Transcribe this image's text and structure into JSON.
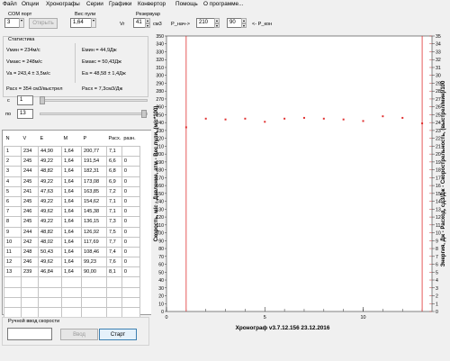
{
  "menu": [
    "Файл",
    "Опции",
    "Хронографы",
    "Серии",
    "Графики",
    "Конвертор",
    "Помощь",
    "О программе..."
  ],
  "top": {
    "com_label": "COM порт",
    "com_value": "3",
    "open_label": "Открыть",
    "weight_label": "Вес пули",
    "weight_value": "1,64",
    "reservoir_label": "Резервуар",
    "vr_label": "Vr",
    "vr_value": "41",
    "cm3_label": "см3",
    "p_start_label": "P_нач->",
    "p_start_value": "210",
    "p_end_value": "90",
    "p_end_label": "<- P_кон"
  },
  "stats": {
    "title": "Статистика",
    "vmin": "Vмин = 234м/с",
    "emin": "Емин = 44,9Дж",
    "vmax": "Vмакс = 248м/с",
    "emax": "Емакс = 50,43Дж",
    "vavg": "Va = 243,4 ± 3,5м/с",
    "eavg": "Еа = 48,58 ± 1,4Дж",
    "flow_shot": "Расх = 354 см3/выстрел",
    "flow": "Расх = 7,3см3/Дж"
  },
  "range": {
    "from_label": "с",
    "from_value": "1",
    "to_label": "по",
    "to_value": "13"
  },
  "table": {
    "headers": [
      "N",
      "V",
      "E",
      "M",
      "P",
      "Расх.",
      "разн."
    ],
    "rows": [
      [
        "1",
        "234",
        "44,90",
        "1,64",
        "200,77",
        "7,1",
        ""
      ],
      [
        "2",
        "245",
        "49,22",
        "1,64",
        "191,54",
        "6,6",
        "0"
      ],
      [
        "3",
        "244",
        "48,82",
        "1,64",
        "182,31",
        "6,8",
        "0"
      ],
      [
        "4",
        "245",
        "49,22",
        "1,64",
        "173,08",
        "6,9",
        "0"
      ],
      [
        "5",
        "241",
        "47,63",
        "1,64",
        "163,85",
        "7,2",
        "0"
      ],
      [
        "6",
        "245",
        "49,22",
        "1,64",
        "154,62",
        "7,1",
        "0"
      ],
      [
        "7",
        "246",
        "49,62",
        "1,64",
        "145,38",
        "7,1",
        "0"
      ],
      [
        "8",
        "245",
        "49,22",
        "1,64",
        "136,15",
        "7,3",
        "0"
      ],
      [
        "9",
        "244",
        "48,82",
        "1,64",
        "126,92",
        "7,5",
        "0"
      ],
      [
        "10",
        "242",
        "48,02",
        "1,64",
        "117,69",
        "7,7",
        "0"
      ],
      [
        "11",
        "248",
        "50,43",
        "1,64",
        "108,46",
        "7,4",
        "0"
      ],
      [
        "12",
        "246",
        "49,62",
        "1,64",
        "99,23",
        "7,6",
        "0"
      ],
      [
        "13",
        "239",
        "46,84",
        "1,64",
        "90,00",
        "8,1",
        "0"
      ]
    ]
  },
  "manual": {
    "label": "Ручной ввод скорости",
    "input_value": "",
    "enter_label": "Ввод",
    "start_label": "Старт"
  },
  "chart_data": {
    "type": "scatter",
    "title": "",
    "xlabel": "Хронограф v3.7.12.156     23.12.2016",
    "ylabel": "Скорость, м/с - Давление, атм - Вес пули, (м/с*100)",
    "y2label": "Энергия, Дж - Расход, сд3/Дж - Скорострельность, (выстрел/мин)/100",
    "x_ticks": [
      "0",
      "5",
      "10"
    ],
    "xlim": [
      0,
      13.5
    ],
    "ylim": [
      0,
      350
    ],
    "y_ticks": [
      0,
      10,
      20,
      30,
      40,
      50,
      60,
      70,
      80,
      90,
      100,
      110,
      120,
      130,
      140,
      150,
      160,
      170,
      180,
      190,
      200,
      210,
      220,
      230,
      240,
      250,
      260,
      270,
      280,
      290,
      300,
      310,
      320,
      330,
      340,
      350
    ],
    "y2lim": [
      0,
      35
    ],
    "y2_ticks": [
      0,
      1,
      2,
      3,
      4,
      5,
      6,
      7,
      8,
      9,
      10,
      11,
      12,
      13,
      14,
      15,
      16,
      17,
      18,
      19,
      20,
      21,
      22,
      23,
      24,
      25,
      26,
      27,
      28,
      29,
      30,
      31,
      32,
      33,
      34,
      35
    ],
    "red_lines_x": [
      1,
      13
    ],
    "series": [
      {
        "values": [
          [
            1,
            234
          ],
          [
            2,
            245
          ],
          [
            3,
            244
          ],
          [
            4,
            245
          ],
          [
            5,
            241
          ],
          [
            6,
            245
          ],
          [
            7,
            246
          ],
          [
            8,
            245
          ],
          [
            9,
            244
          ],
          [
            10,
            242
          ],
          [
            11,
            248
          ],
          [
            12,
            246
          ],
          [
            13,
            239
          ]
        ]
      }
    ],
    "colors": {
      "points": "#e03030",
      "lines": "#e03030",
      "ticks_right": "#c04040"
    }
  }
}
